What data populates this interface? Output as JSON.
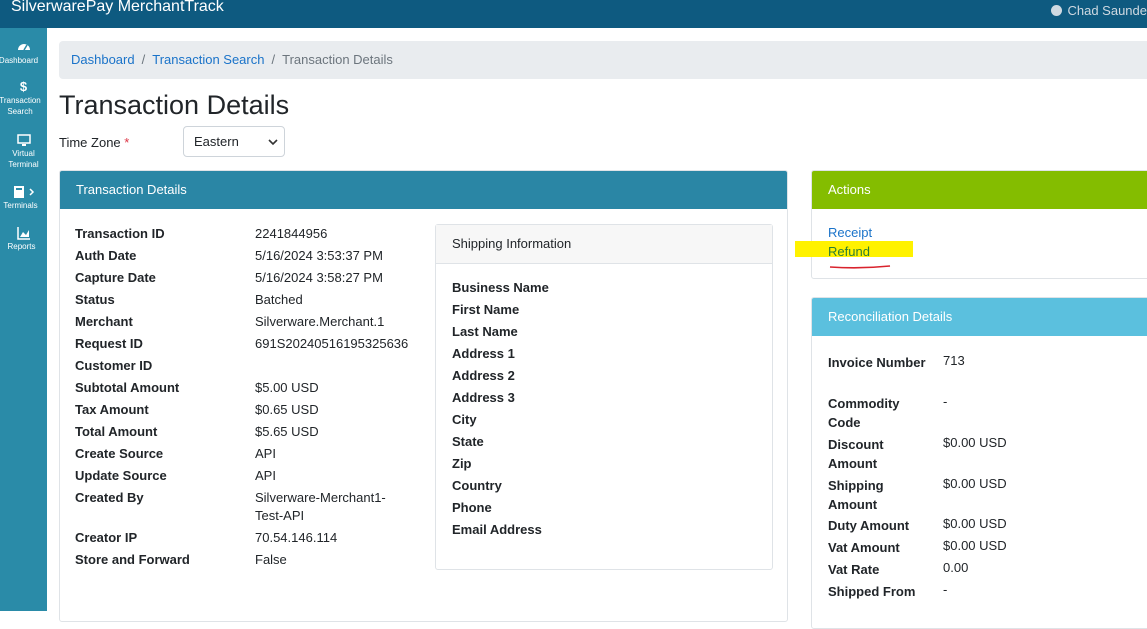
{
  "app": {
    "title": "SilverwarePay MerchantTrack",
    "user": "Chad Saunde",
    "user_icon": "user-circle-icon"
  },
  "sidebar": {
    "items": [
      {
        "label": "Dashboard",
        "icon": "speedometer-icon"
      },
      {
        "label": "Transaction Search",
        "icon": "dollar-icon"
      },
      {
        "label": "Virtual Terminal",
        "icon": "monitor-icon"
      },
      {
        "label": "Terminals",
        "icon": "calculator-icon"
      },
      {
        "label": "Reports",
        "icon": "chart-icon"
      }
    ]
  },
  "breadcrumb": {
    "items": [
      "Dashboard",
      "Transaction Search"
    ],
    "current": "Transaction Details"
  },
  "page": {
    "title": "Transaction Details"
  },
  "timezone": {
    "label": "Time Zone",
    "required_mark": "*",
    "value": "Eastern"
  },
  "details": {
    "header": "Transaction Details",
    "rows": [
      {
        "label": "Transaction ID",
        "value": "2241844956"
      },
      {
        "label": "Auth Date",
        "value": "5/16/2024 3:53:37 PM"
      },
      {
        "label": "Capture Date",
        "value": "5/16/2024 3:58:27 PM"
      },
      {
        "label": "Status",
        "value": "Batched"
      },
      {
        "label": "Merchant",
        "value": "Silverware.Merchant.1"
      },
      {
        "label": "Request ID",
        "value": "691S20240516195325636"
      },
      {
        "label": "Customer ID",
        "value": ""
      },
      {
        "label": "Subtotal Amount",
        "value": "$5.00 USD"
      },
      {
        "label": "Tax Amount",
        "value": "$0.65 USD"
      },
      {
        "label": "Total Amount",
        "value": "$5.65 USD"
      },
      {
        "label": "Create Source",
        "value": "API"
      },
      {
        "label": "Update Source",
        "value": "API"
      },
      {
        "label": "Created By",
        "value": "Silverware-Merchant1-",
        "value2": "Test-API"
      },
      {
        "label": "Creator IP",
        "value": "70.54.146.114"
      },
      {
        "label": "Store and Forward",
        "value": "False"
      }
    ]
  },
  "shipping": {
    "header": "Shipping Information",
    "fields": [
      "Business Name",
      "First Name",
      "Last Name",
      "Address 1",
      "Address 2",
      "Address 3",
      "City",
      "State",
      "Zip",
      "Country",
      "Phone",
      "Email Address"
    ]
  },
  "actions": {
    "header": "Actions",
    "receipt": "Receipt",
    "refund": "Refund"
  },
  "reconciliation": {
    "header": "Reconciliation Details",
    "rows": [
      {
        "label": "Invoice Number",
        "value": "713"
      },
      {
        "label": "Commodity Code",
        "value": "-"
      },
      {
        "label": "Discount Amount",
        "value": "$0.00 USD"
      },
      {
        "label": "Shipping Amount",
        "value": "$0.00 USD"
      },
      {
        "label": "Duty Amount",
        "value": "$0.00 USD"
      },
      {
        "label": "Vat Amount",
        "value": "$0.00 USD"
      },
      {
        "label": "Vat Rate",
        "value": "0.00"
      },
      {
        "label": "Shipped From",
        "value": "-"
      }
    ]
  },
  "colors": {
    "topbar": "#0e5a80",
    "sidebar": "#2a8ba8",
    "details_header": "#2a86a5",
    "actions_header": "#84bd00",
    "recon_header": "#5bc0de",
    "link": "#1a73c9",
    "highlight": "#fff200",
    "annotation": "#d9232d"
  }
}
